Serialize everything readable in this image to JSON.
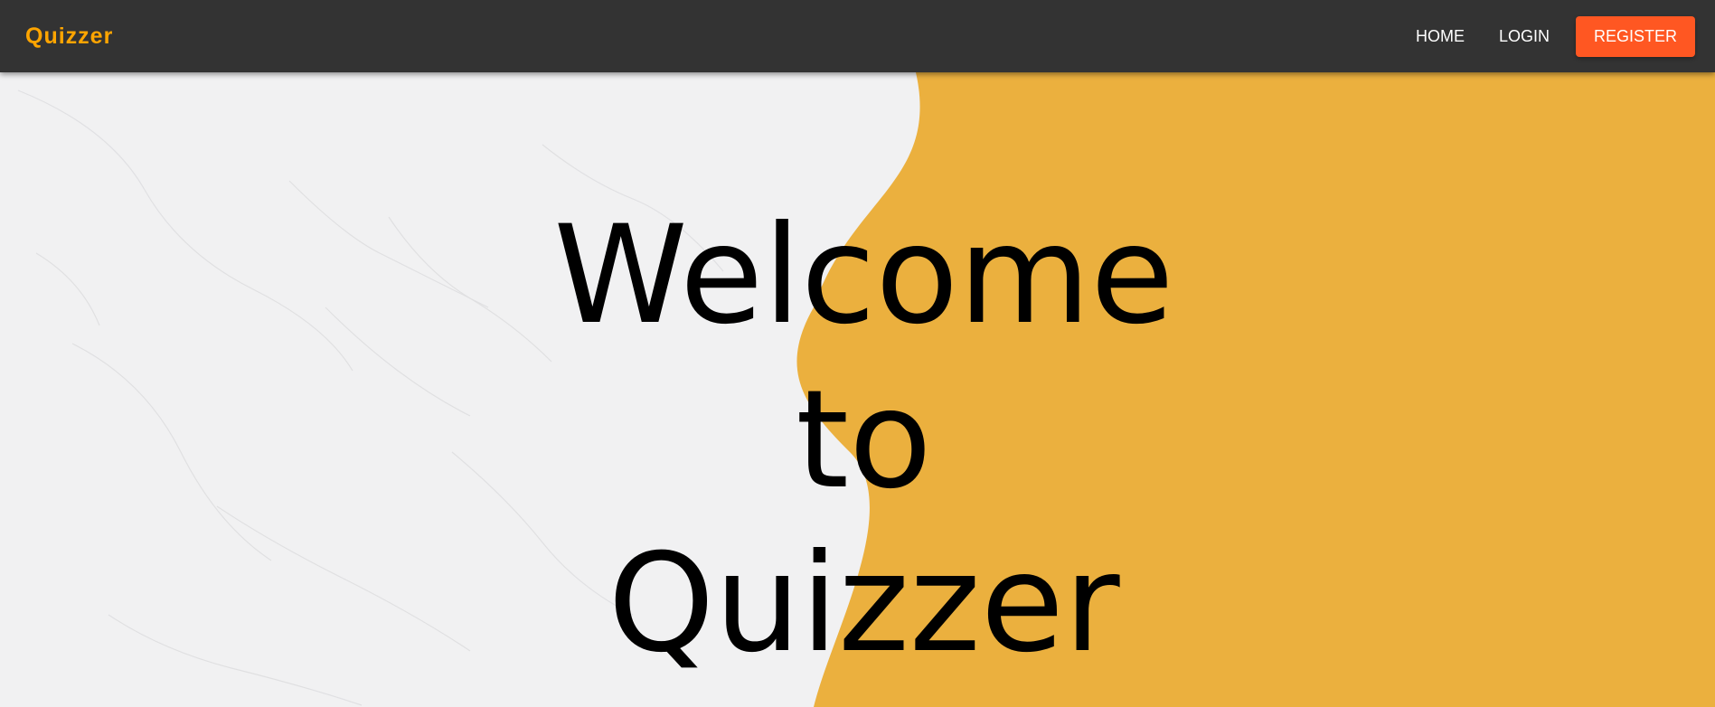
{
  "navbar": {
    "brand": "Quizzer",
    "links": [
      {
        "label": "HOME"
      },
      {
        "label": "LOGIN"
      }
    ],
    "register_label": "REGISTER"
  },
  "hero": {
    "heading_lines": [
      "Welcome",
      "to",
      "Quizzer"
    ]
  },
  "colors": {
    "navbar_bg": "#333333",
    "brand": "#ffa500",
    "register_bg": "#ff5722",
    "hero_accent": "#ebb03e",
    "hero_marble": "#f1f1f2"
  }
}
